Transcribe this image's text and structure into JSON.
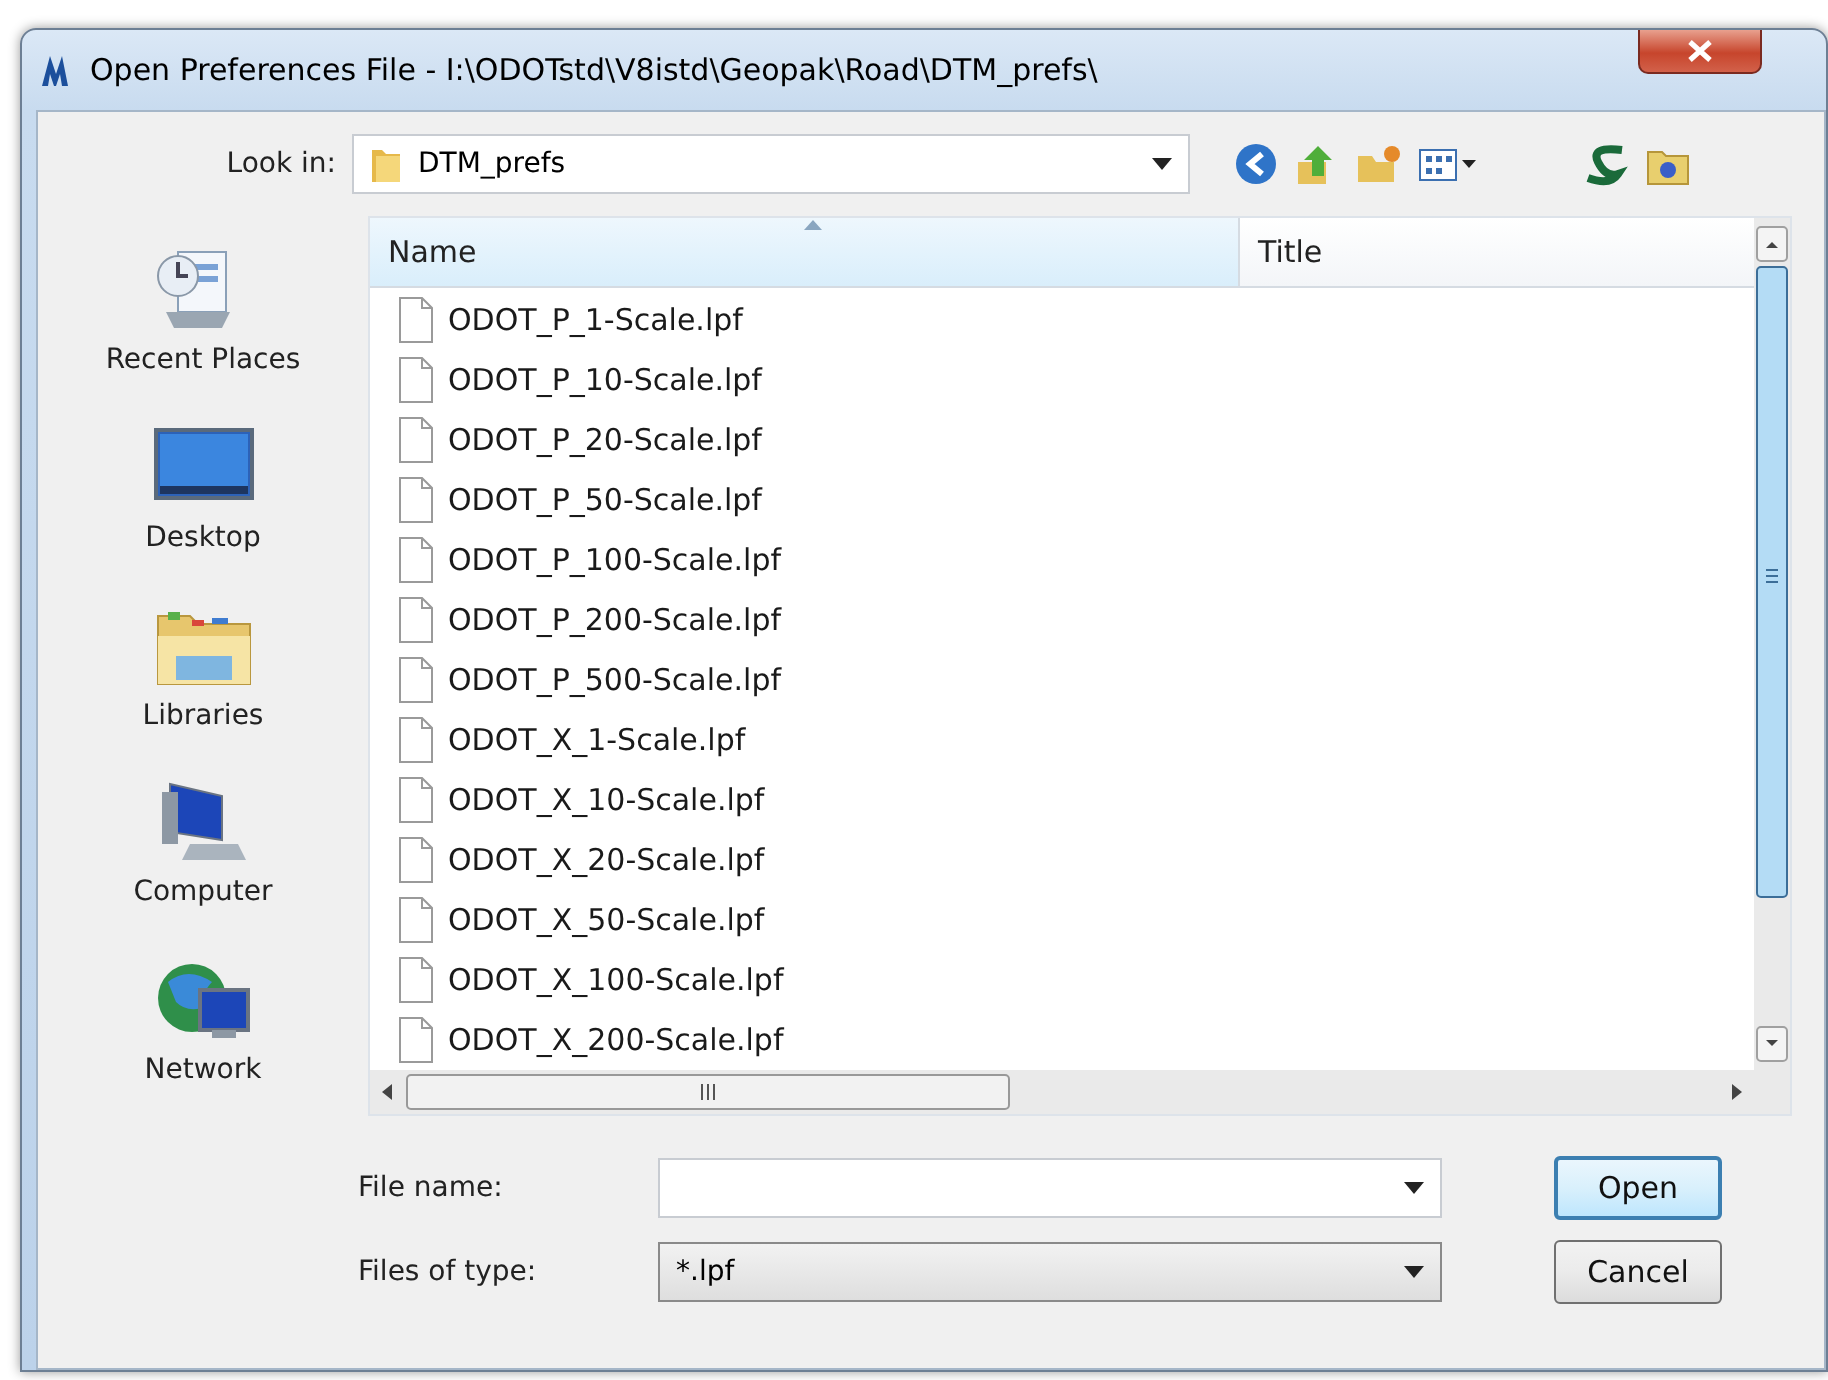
{
  "window": {
    "title": "Open Preferences File - I:\\ODOTstd\\V8istd\\Geopak\\Road\\DTM_prefs\\"
  },
  "look_in": {
    "label": "Look in:",
    "value": "DTM_prefs"
  },
  "places": [
    {
      "label": "Recent Places",
      "kind": "recent"
    },
    {
      "label": "Desktop",
      "kind": "desktop"
    },
    {
      "label": "Libraries",
      "kind": "libraries"
    },
    {
      "label": "Computer",
      "kind": "computer"
    },
    {
      "label": "Network",
      "kind": "network"
    }
  ],
  "file_list": {
    "columns": [
      {
        "label": "Name",
        "sorted": true
      },
      {
        "label": "Title",
        "sorted": false
      }
    ],
    "files": [
      "ODOT_P_1-Scale.lpf",
      "ODOT_P_10-Scale.lpf",
      "ODOT_P_20-Scale.lpf",
      "ODOT_P_50-Scale.lpf",
      "ODOT_P_100-Scale.lpf",
      "ODOT_P_200-Scale.lpf",
      "ODOT_P_500-Scale.lpf",
      "ODOT_X_1-Scale.lpf",
      "ODOT_X_10-Scale.lpf",
      "ODOT_X_20-Scale.lpf",
      "ODOT_X_50-Scale.lpf",
      "ODOT_X_100-Scale.lpf",
      "ODOT_X_200-Scale.lpf"
    ]
  },
  "file_name": {
    "label": "File name:"
  },
  "file_type": {
    "label": "Files of type:",
    "value": "*.lpf"
  },
  "buttons": [
    {
      "label": "Open",
      "default": true
    },
    {
      "label": "Cancel",
      "default": false
    }
  ]
}
